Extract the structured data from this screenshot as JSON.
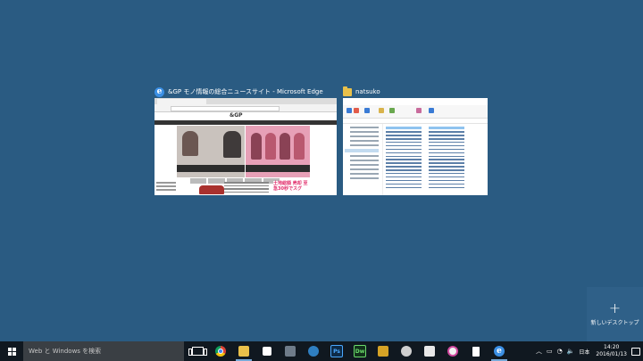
{
  "task_view": {
    "windows": [
      {
        "title": "&GP モノ情報の総合ニュースサイト - Microsoft Edge",
        "icon": "edge-icon"
      },
      {
        "title": "natsuko",
        "icon": "folder-icon"
      }
    ],
    "edge_thumbnail": {
      "site_logo": "&GP",
      "ad_text": "土地総額 売却 至急30秒でスグ"
    },
    "new_desktop": {
      "label": "新しいデスクトップ",
      "icon": "plus-icon",
      "plus": "+"
    }
  },
  "taskbar": {
    "search_placeholder": "Web と Windows を検索",
    "apps": [
      {
        "name": "task-view",
        "icon": "task-view-icon"
      },
      {
        "name": "chrome",
        "icon": "chrome-icon"
      },
      {
        "name": "file-explorer",
        "icon": "file-explorer-icon",
        "running": true
      },
      {
        "name": "store",
        "icon": "store-icon"
      },
      {
        "name": "app",
        "icon": "app-icon"
      },
      {
        "name": "app",
        "icon": "app-icon"
      },
      {
        "name": "photoshop",
        "icon": "photoshop-icon",
        "label": "Ps"
      },
      {
        "name": "dreamweaver",
        "icon": "dreamweaver-icon",
        "label": "Dw"
      },
      {
        "name": "app",
        "icon": "app-icon"
      },
      {
        "name": "app",
        "icon": "app-icon"
      },
      {
        "name": "app",
        "icon": "app-icon"
      },
      {
        "name": "itunes",
        "icon": "itunes-icon"
      },
      {
        "name": "app",
        "icon": "app-icon"
      },
      {
        "name": "edge",
        "icon": "edge-icon",
        "running": true
      }
    ],
    "tray": {
      "language": "日本",
      "time": "14:20",
      "date": "2016/01/13"
    }
  },
  "colors": {
    "desktop": "#2a5b82",
    "taskbar": "#101820",
    "search_box": "#3a3f44",
    "accent": "#76a9d8"
  }
}
